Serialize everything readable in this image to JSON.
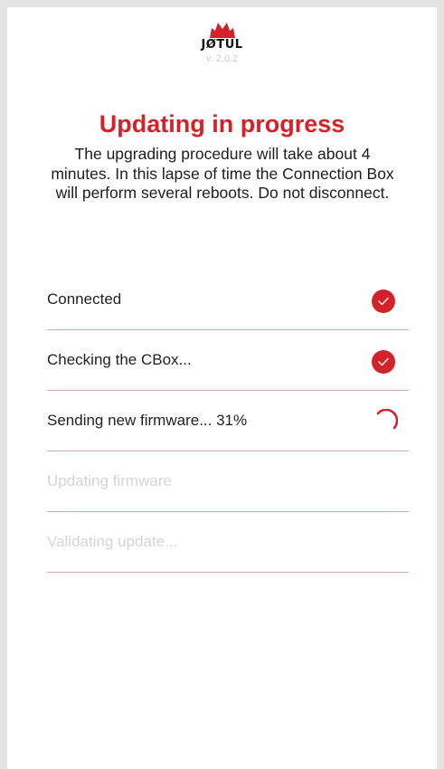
{
  "header": {
    "brand": "JØTUL",
    "version": "v. 2.0.2",
    "brand_color": "#d3222a"
  },
  "title": "Updating in progress",
  "description": "The upgrading procedure will take about 4 minutes. In this lapse of time the Connection Box will perform several reboots. Do not disconnect.",
  "steps": [
    {
      "label": "Connected",
      "status": "done",
      "icon": "check-icon"
    },
    {
      "label": "Checking the CBox...",
      "status": "done",
      "icon": "check-icon"
    },
    {
      "label": "Sending new firmware... 31%",
      "status": "in-progress",
      "icon": "spinner-icon"
    },
    {
      "label": "Updating firmware",
      "status": "pending"
    },
    {
      "label": "Validating update...",
      "status": "pending"
    }
  ]
}
